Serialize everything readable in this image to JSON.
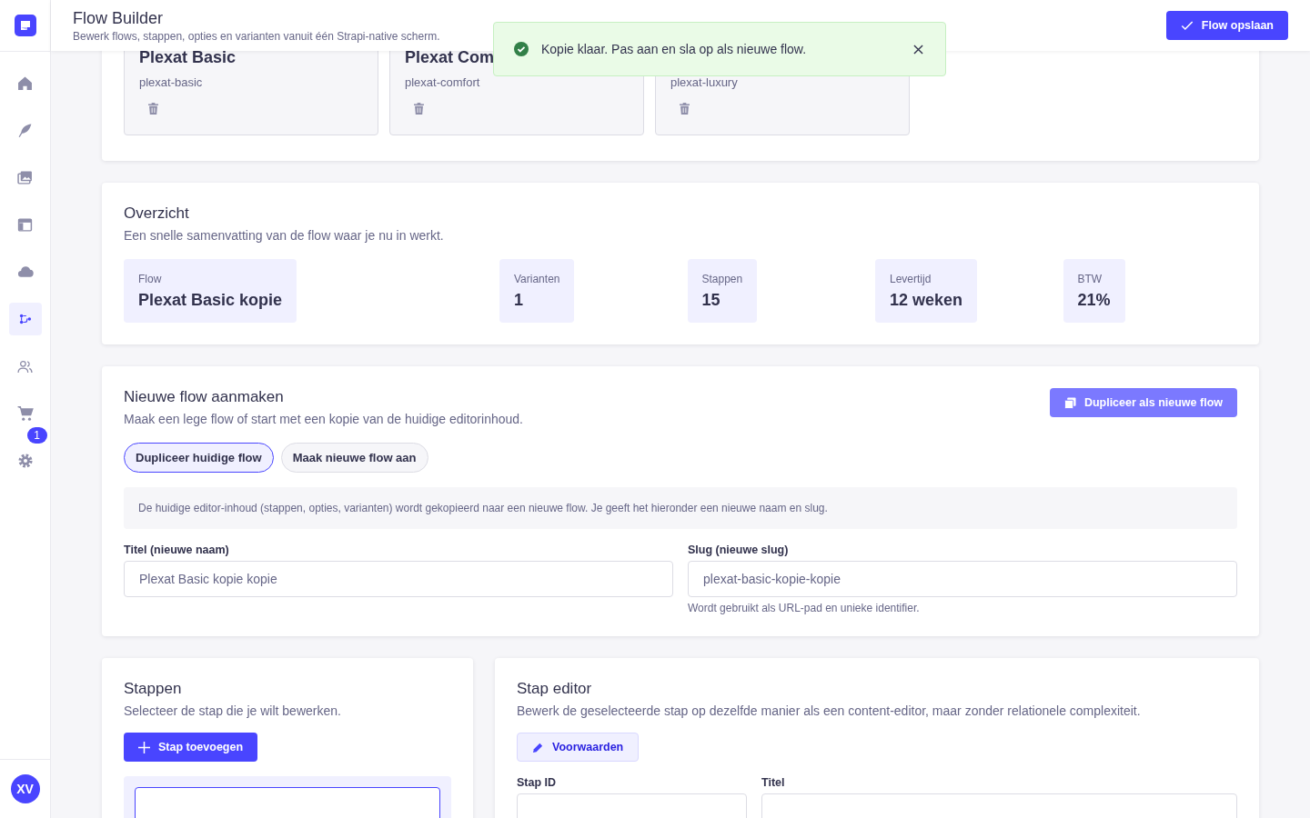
{
  "sidebar": {
    "items": [
      {
        "kind": "home",
        "selected": false
      },
      {
        "kind": "feather",
        "selected": false
      },
      {
        "kind": "images",
        "selected": false
      },
      {
        "kind": "layout",
        "selected": false
      },
      {
        "kind": "cloud",
        "selected": false
      },
      {
        "kind": "flow",
        "selected": true
      },
      {
        "kind": "users",
        "selected": false
      },
      {
        "kind": "cart",
        "selected": false
      },
      {
        "kind": "gear",
        "selected": false,
        "badge": "1"
      }
    ],
    "avatar": "XV"
  },
  "header": {
    "title": "Flow Builder",
    "subtitle": "Bewerk flows, stappen, opties en varianten vanuit één Strapi-native scherm.",
    "save_button": "Flow opslaan"
  },
  "toast": {
    "message": "Kopie klaar. Pas aan en sla op als nieuwe flow."
  },
  "flows": [
    {
      "name": "Plexat Basic",
      "slug": "plexat-basic"
    },
    {
      "name": "Plexat Com",
      "slug": "plexat-comfort"
    },
    {
      "slug": "plexat-luxury"
    }
  ],
  "overview": {
    "title": "Overzicht",
    "subtitle": "Een snelle samenvatting van de flow waar je nu in werkt.",
    "stats": [
      {
        "label": "Flow",
        "value": "Plexat Basic kopie",
        "wide": true
      },
      {
        "label": "Varianten",
        "value": "1",
        "wide": false
      },
      {
        "label": "Stappen",
        "value": "15",
        "wide": false
      },
      {
        "label": "Levertijd",
        "value": "12 weken",
        "wide": false
      },
      {
        "label": "BTW",
        "value": "21%",
        "wide": false
      }
    ]
  },
  "new_flow": {
    "title": "Nieuwe flow aanmaken",
    "subtitle": "Maak een lege flow of start met een kopie van de huidige editorinhoud.",
    "duplicate_button": "Dupliceer als nieuwe flow",
    "modes": [
      {
        "label": "Dupliceer huidige flow",
        "selected": true
      },
      {
        "label": "Maak nieuwe flow aan",
        "selected": false
      }
    ],
    "info": "De huidige editor-inhoud (stappen, opties, varianten) wordt gekopieerd naar een nieuwe flow. Je geeft het hieronder een nieuwe naam en slug.",
    "fields": [
      {
        "label": "Titel (nieuwe naam)",
        "value": "Plexat Basic kopie kopie"
      },
      {
        "label": "Slug (nieuwe slug)",
        "value": "plexat-basic-kopie-kopie",
        "hint": "Wordt gebruikt als URL-pad en unieke identifier."
      }
    ]
  },
  "steps": {
    "title": "Stappen",
    "subtitle": "Selecteer de stap die je wilt bewerken.",
    "add_button": "Stap toevoegen",
    "items": [
      {
        "selected": true
      }
    ]
  },
  "step_editor": {
    "title": "Stap editor",
    "subtitle": "Bewerk de geselecteerde stap op dezelfde manier als een content-editor, maar zonder relationele complexiteit.",
    "conditions_button": "Voorwaarden",
    "fields": [
      {
        "label": "Stap ID"
      },
      {
        "label": "Titel"
      }
    ]
  }
}
